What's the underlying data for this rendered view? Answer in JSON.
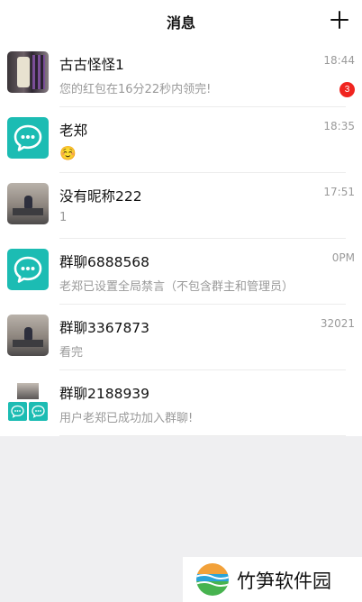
{
  "header": {
    "title": "消息",
    "add_icon": "plus-icon"
  },
  "conversations": [
    {
      "name": "古古怪怪1",
      "preview": "您的红包在16分22秒内领完!",
      "time": "18:44",
      "unread": "3",
      "avatar": "photo"
    },
    {
      "name": "老郑",
      "preview": "☺️",
      "time": "18:35",
      "avatar": "chat-bubble-icon"
    },
    {
      "name": "没有昵称222",
      "preview": "1",
      "time": "17:51",
      "avatar": "photo"
    },
    {
      "name": "群聊6888568",
      "preview": "老郑已设置全局禁言（不包含群主和管理员）",
      "time": "0PM",
      "avatar": "chat-bubble-icon"
    },
    {
      "name": "群聊3367873",
      "preview": "看完",
      "time": "32021",
      "avatar": "photo"
    },
    {
      "name": "群聊2188939",
      "preview": "用户老郑已成功加入群聊!",
      "time": "",
      "avatar": "group-collage"
    }
  ],
  "watermark": {
    "text": "竹笋软件园",
    "icon": "bamboo-logo-icon"
  },
  "colors": {
    "accent": "#1cbcb3",
    "badge": "#f0241f",
    "background": "#efeff1"
  }
}
